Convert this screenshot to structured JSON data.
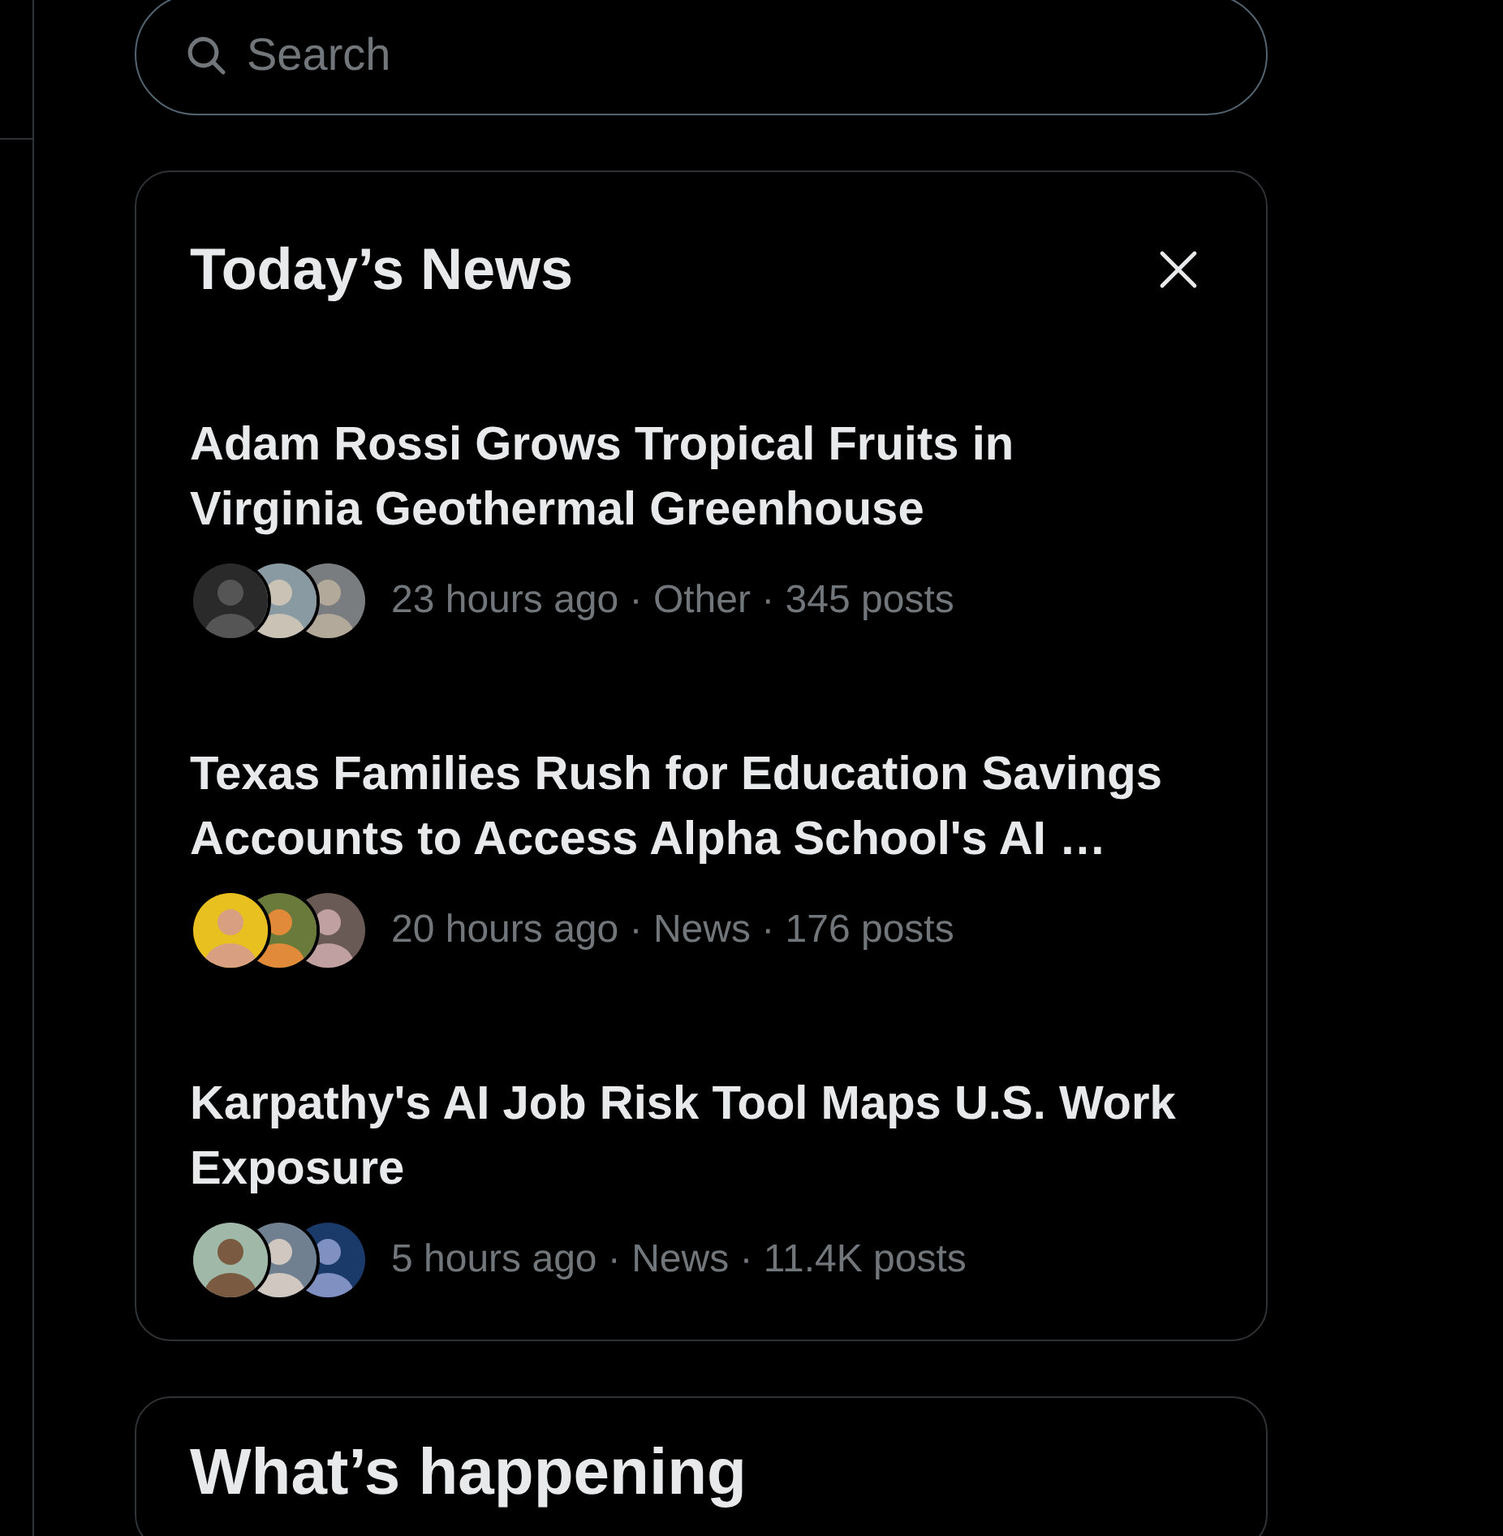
{
  "search": {
    "placeholder": "Search"
  },
  "news": {
    "title": "Today’s News",
    "items": [
      {
        "headline": "Adam Rossi Grows Tropical Fruits in Virginia Geothermal Greenhouse",
        "meta": "23 hours ago · Other · 345 posts"
      },
      {
        "headline": "Texas Families Rush for Education Savings Accounts to Access Alpha School's AI …",
        "meta": "20 hours ago · News · 176 posts"
      },
      {
        "headline": "Karpathy's AI Job Risk Tool Maps U.S. Work Exposure",
        "meta": "5 hours ago · News · 11.4K posts"
      }
    ]
  },
  "happening": {
    "title": "What’s happening"
  }
}
